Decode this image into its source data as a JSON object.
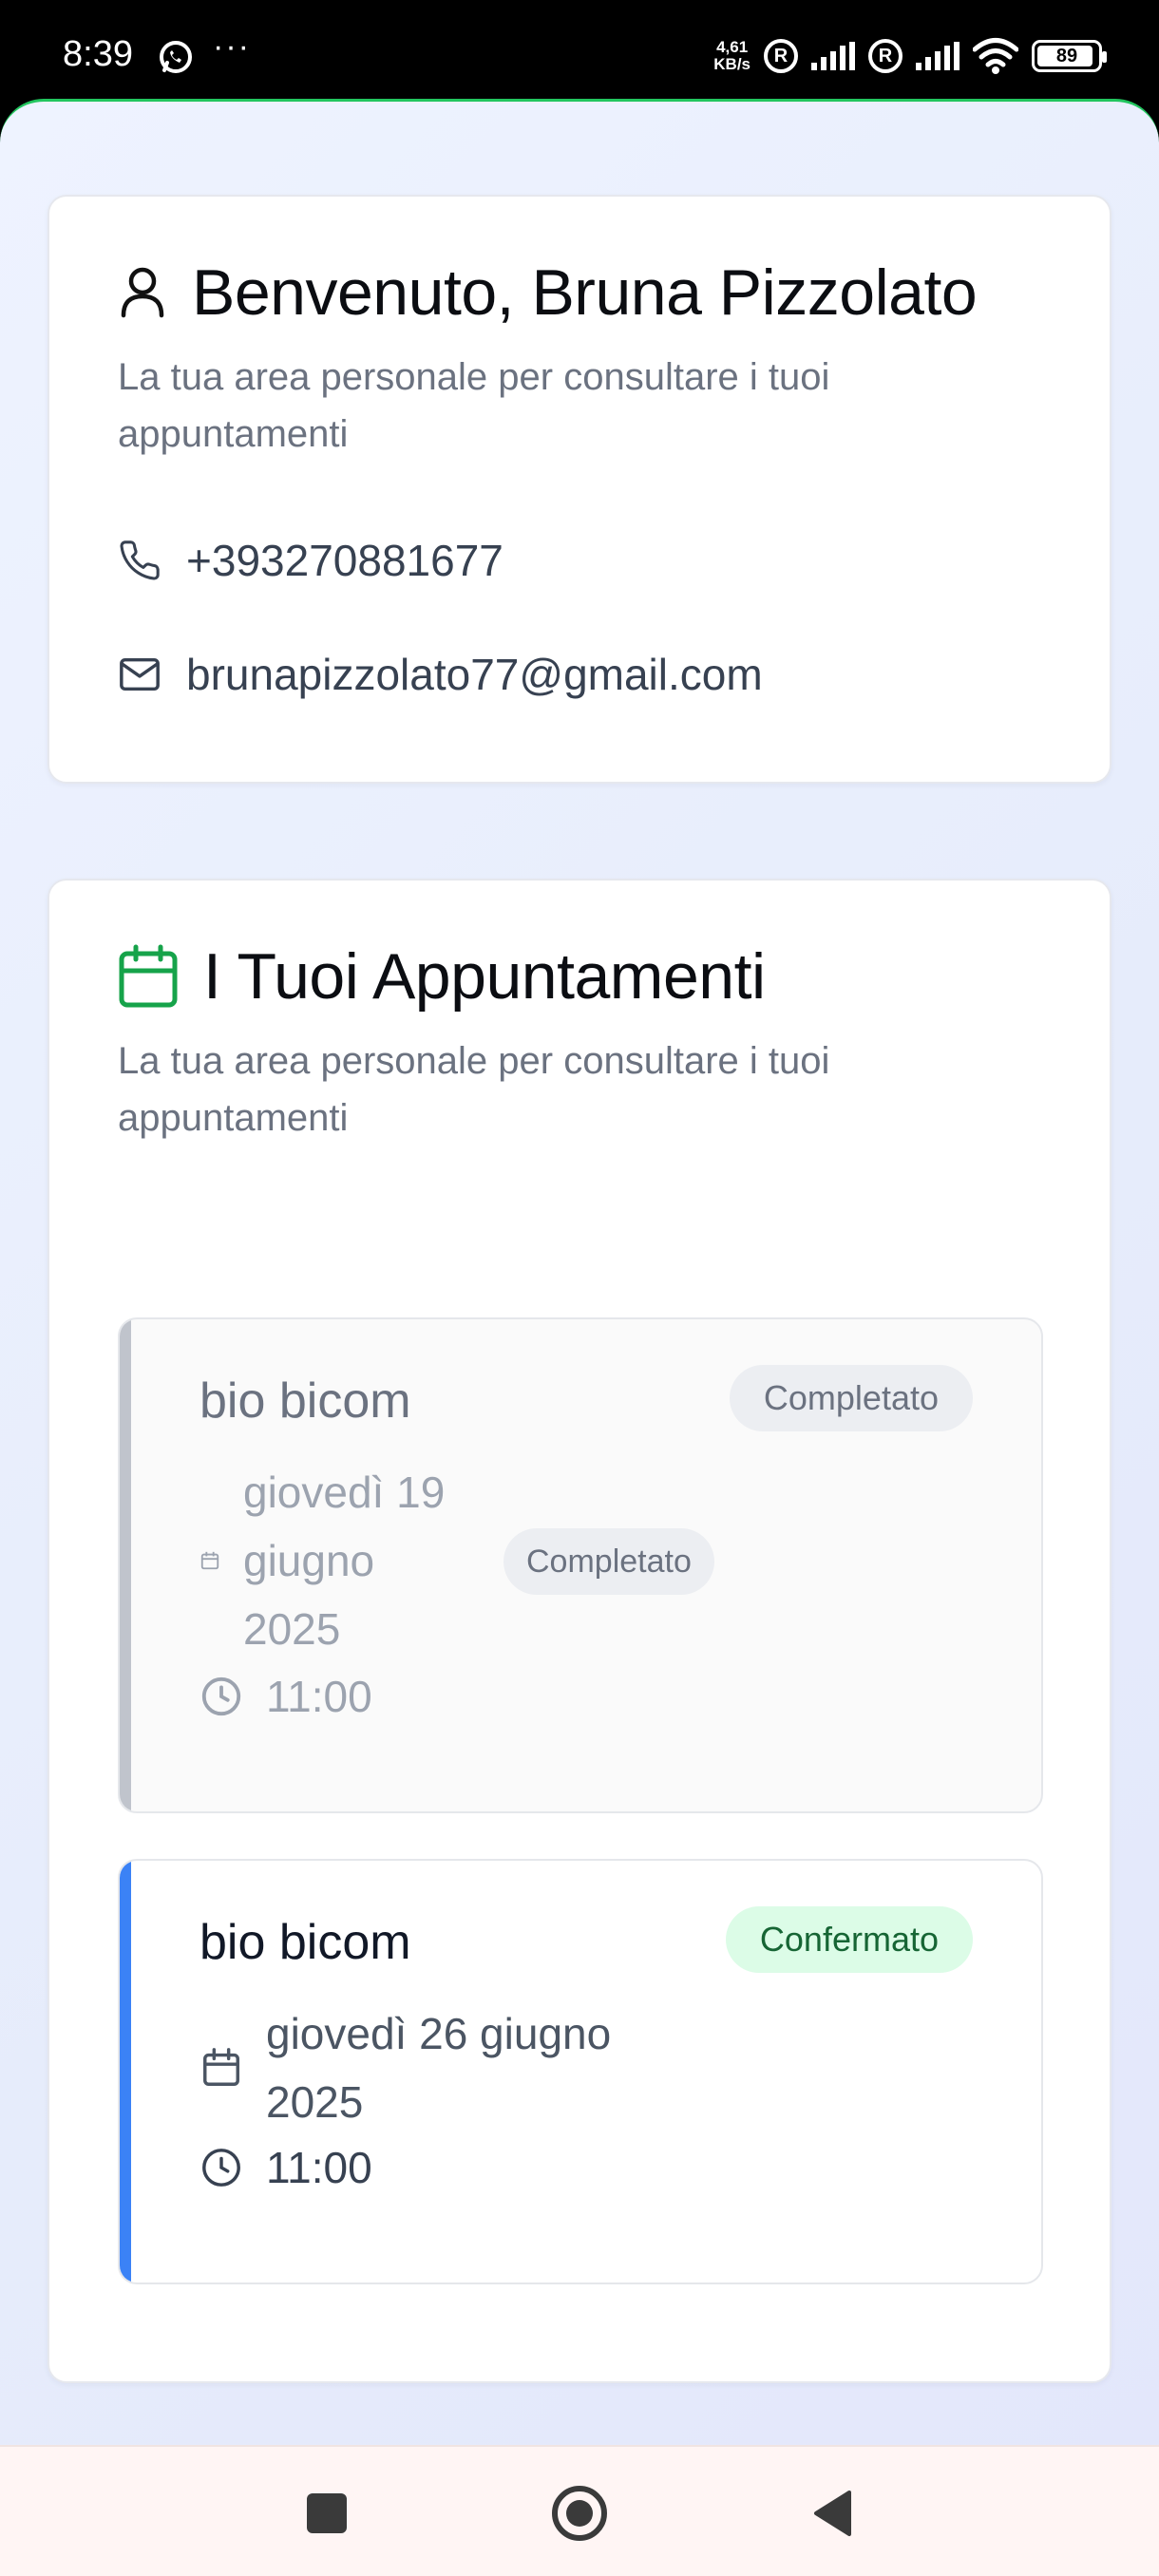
{
  "status_bar": {
    "time": "8:39",
    "speed_value": "4,61",
    "speed_unit": "KB/s",
    "roaming_1": "R",
    "roaming_2": "R",
    "battery": "89",
    "icons": [
      "whatsapp-icon",
      "more-icon",
      "signal-icon",
      "wifi-icon",
      "battery-icon"
    ]
  },
  "profile": {
    "title": "Benvenuto, Bruna Pizzolato",
    "subtitle": "La tua area personale per consultare i tuoi appuntamenti",
    "phone": "+393270881677",
    "email": "brunapizzolato77@gmail.com",
    "icons": [
      "user-icon",
      "phone-icon",
      "mail-icon"
    ]
  },
  "appointments": {
    "title": "I Tuoi Appuntamenti",
    "subtitle": "La tua area personale per consultare i tuoi appuntamenti",
    "accent_color": "#16a34a",
    "items": [
      {
        "name": "bio bicom",
        "status": "Completato",
        "date": "giovedì 19 giugno 2025",
        "date_status": "Completato",
        "time": "11:00",
        "accent": "#c0c4cc"
      },
      {
        "name": "bio bicom",
        "status": "Confermato",
        "date": "giovedì 26 giugno 2025",
        "time": "11:00",
        "accent": "#3b82f6"
      }
    ]
  },
  "nav_bar": {
    "buttons": [
      "recents-button",
      "home-button",
      "back-button"
    ]
  }
}
